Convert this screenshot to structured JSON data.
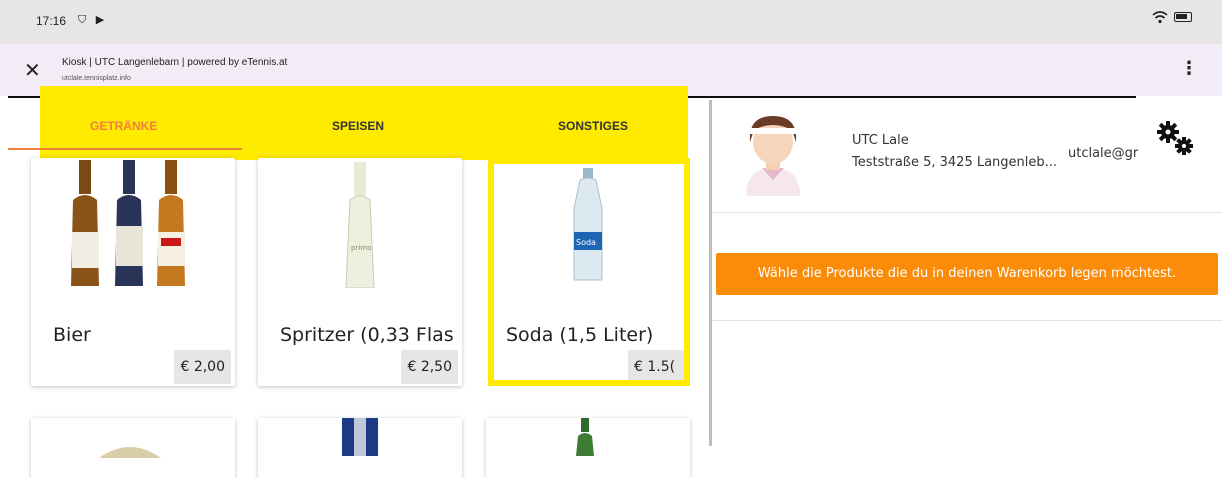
{
  "status": {
    "time": "17:16",
    "left_icons": "⛉ ▶"
  },
  "browser": {
    "title": "Kiosk | UTC Langenlebarn | powered by eTennis.at",
    "url": "utclale.tennisplatz.info",
    "close_icon": "✕",
    "menu_icon": "⋮"
  },
  "tabs": [
    {
      "label": "GETRÄNKE",
      "active": true
    },
    {
      "label": "SPEISEN",
      "active": false
    },
    {
      "label": "SONSTIGES",
      "active": false
    }
  ],
  "products": [
    {
      "name": "Bier",
      "price": "€ 2,00",
      "icon": "beer-bottles-icon"
    },
    {
      "name": "Spritzer (0,33 Flas",
      "price": "€ 2,50",
      "icon": "spritzer-bottle-icon"
    },
    {
      "name": "Soda (1,5 Liter)",
      "price": "€ 1.5(",
      "icon": "soda-bottle-icon"
    }
  ],
  "shop": {
    "name": "UTC Lale",
    "address": "Teststraße 5, 3425 Langenleb...",
    "email": "utclale@gr"
  },
  "hint": "Wähle die Produkte die du in deinen Warenkorb legen möchtest.",
  "colors": {
    "accent": "#f0803c",
    "hint_bg": "#fb8c0a",
    "highlight": "#ffeb00"
  }
}
